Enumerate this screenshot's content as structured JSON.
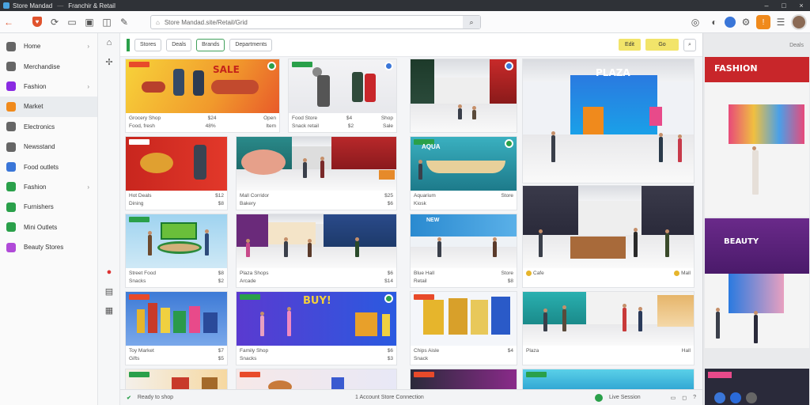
{
  "window": {
    "title": "Store Mandad",
    "subtitle": "Franchir & Retail"
  },
  "toolbar": {
    "url": "Store Mandad.site/Retail/Grid",
    "go_icon": "search-icon"
  },
  "sidebar": {
    "items": [
      {
        "label": "Home",
        "icon": "home-icon",
        "color": "#666666",
        "chevron": true
      },
      {
        "label": "Merchandise",
        "icon": "tools-icon",
        "color": "#666666",
        "chevron": false
      },
      {
        "label": "Fashion",
        "icon": "hanger-icon",
        "color": "#8a2be2",
        "chevron": true
      },
      {
        "label": "Market",
        "icon": "basket-icon",
        "color": "#f08a1c",
        "chevron": false,
        "active": true
      },
      {
        "label": "Electronics",
        "icon": "chip-icon",
        "color": "#666666",
        "chevron": false
      },
      {
        "label": "Newsstand",
        "icon": "doc-icon",
        "color": "#666666",
        "chevron": false
      },
      {
        "label": "Food outlets",
        "icon": "food-icon",
        "color": "#3a76d8",
        "chevron": false
      },
      {
        "label": "Fashion",
        "icon": "tag-icon",
        "color": "#2aa04a",
        "chevron": true
      },
      {
        "label": "Furnishers",
        "icon": "box-icon",
        "color": "#2aa04a",
        "chevron": false
      },
      {
        "label": "Mini Outlets",
        "icon": "store-icon",
        "color": "#2aa04a",
        "chevron": false
      },
      {
        "label": "Beauty Stores",
        "icon": "beauty-icon",
        "color": "#b04ad8",
        "chevron": false
      }
    ]
  },
  "filters": {
    "chips": [
      "Stores",
      "Deals",
      "Brands",
      "Departments"
    ],
    "actions": [
      "Edit",
      "Go"
    ]
  },
  "cards": [
    {
      "tag": "green",
      "l1": "Grocery Shop",
      "r1": "$24",
      "l2": "Food, fresh",
      "r2": "48%",
      "r3": "Open",
      "r4": "Item"
    },
    {
      "tag": "green",
      "l1": "Food Store",
      "r1": "$4",
      "l2": "Snack retail",
      "r2": "$2",
      "r3": "Shop",
      "r4": "Sale"
    },
    {
      "tag": "red",
      "l1": "Hot Deals",
      "r1": "$12",
      "l2": "Dining",
      "r2": "$8",
      "r3": "",
      "r4": ""
    },
    {
      "tag": "red",
      "l1": "Mall Corridor",
      "r1": "$25",
      "l2": "Bakery",
      "r2": "$6",
      "r3": "",
      "r4": ""
    },
    {
      "tag": "green",
      "l1": "Aquarium",
      "r1": "Store",
      "l2": "Kiosk",
      "r2": "",
      "r3": "",
      "r4": ""
    },
    {
      "tag": "green",
      "l1": "Street Food",
      "r1": "$8",
      "l2": "Snacks",
      "r2": "$2",
      "r3": "",
      "r4": ""
    },
    {
      "tag": "red",
      "l1": "Plaza Shops",
      "r1": "$6",
      "l2": "Arcade",
      "r2": "$14",
      "r3": "",
      "r4": ""
    },
    {
      "tag": "green",
      "l1": "Blue Hall",
      "r1": "Store",
      "l2": "Retail",
      "r2": "$8",
      "r3": "",
      "r4": ""
    },
    {
      "tag": "red",
      "l1": "Toy Market",
      "r1": "$7",
      "l2": "Gifts",
      "r2": "$5",
      "r3": "",
      "r4": ""
    },
    {
      "tag": "green",
      "l1": "Family Shop",
      "r1": "$6",
      "l2": "Snacks",
      "r2": "$3",
      "r3": "",
      "r4": ""
    },
    {
      "tag": "green",
      "l1": "Chips Aisle",
      "r1": "$4",
      "l2": "Snack",
      "r2": "",
      "r3": "",
      "r4": ""
    }
  ],
  "right_panel": {
    "header": "Deals"
  },
  "status": {
    "left": "Ready to shop",
    "center": "1 Account Store Connection",
    "right": "Live Session"
  },
  "colors": {
    "accent": "#2aa04a",
    "brand": "#e84a2a",
    "highlight": "#f2e46a"
  }
}
